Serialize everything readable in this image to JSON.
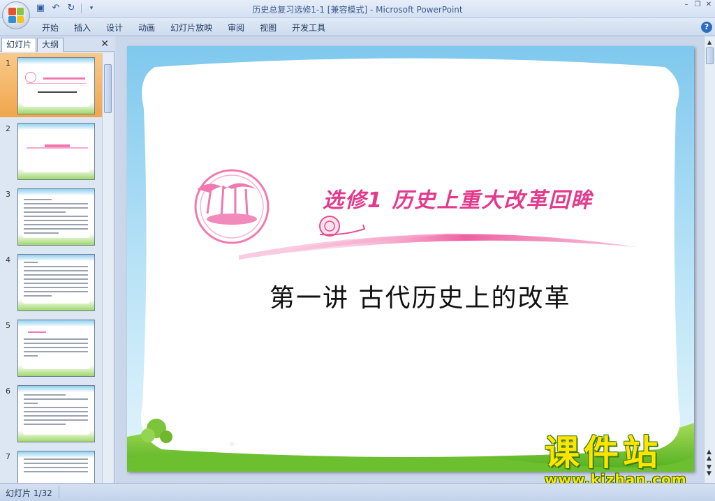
{
  "window": {
    "title": "历史总复习选修1-1 [兼容模式] - Microsoft PowerPoint"
  },
  "ribbon": {
    "tabs": [
      "开始",
      "插入",
      "设计",
      "动画",
      "幻灯片放映",
      "审阅",
      "视图",
      "开发工具"
    ]
  },
  "panel": {
    "tab_slides": "幻灯片",
    "tab_outline": "大纲",
    "thumbnails": [
      {
        "num": "1"
      },
      {
        "num": "2"
      },
      {
        "num": "3"
      },
      {
        "num": "4"
      },
      {
        "num": "5"
      },
      {
        "num": "6"
      },
      {
        "num": "7"
      }
    ]
  },
  "slide": {
    "title": "选修1  历史上重大改革回眸",
    "subtitle": "第一讲    古代历史上的改革"
  },
  "watermark": {
    "brand": "课件站",
    "url": "www.kjzhan.com"
  },
  "status": {
    "slide_counter": "幻灯片 1/32"
  },
  "colors": {
    "accent_pink": "#e33a8e",
    "selection": "#f0a64b",
    "watermark_yellow": "#ffe400"
  }
}
